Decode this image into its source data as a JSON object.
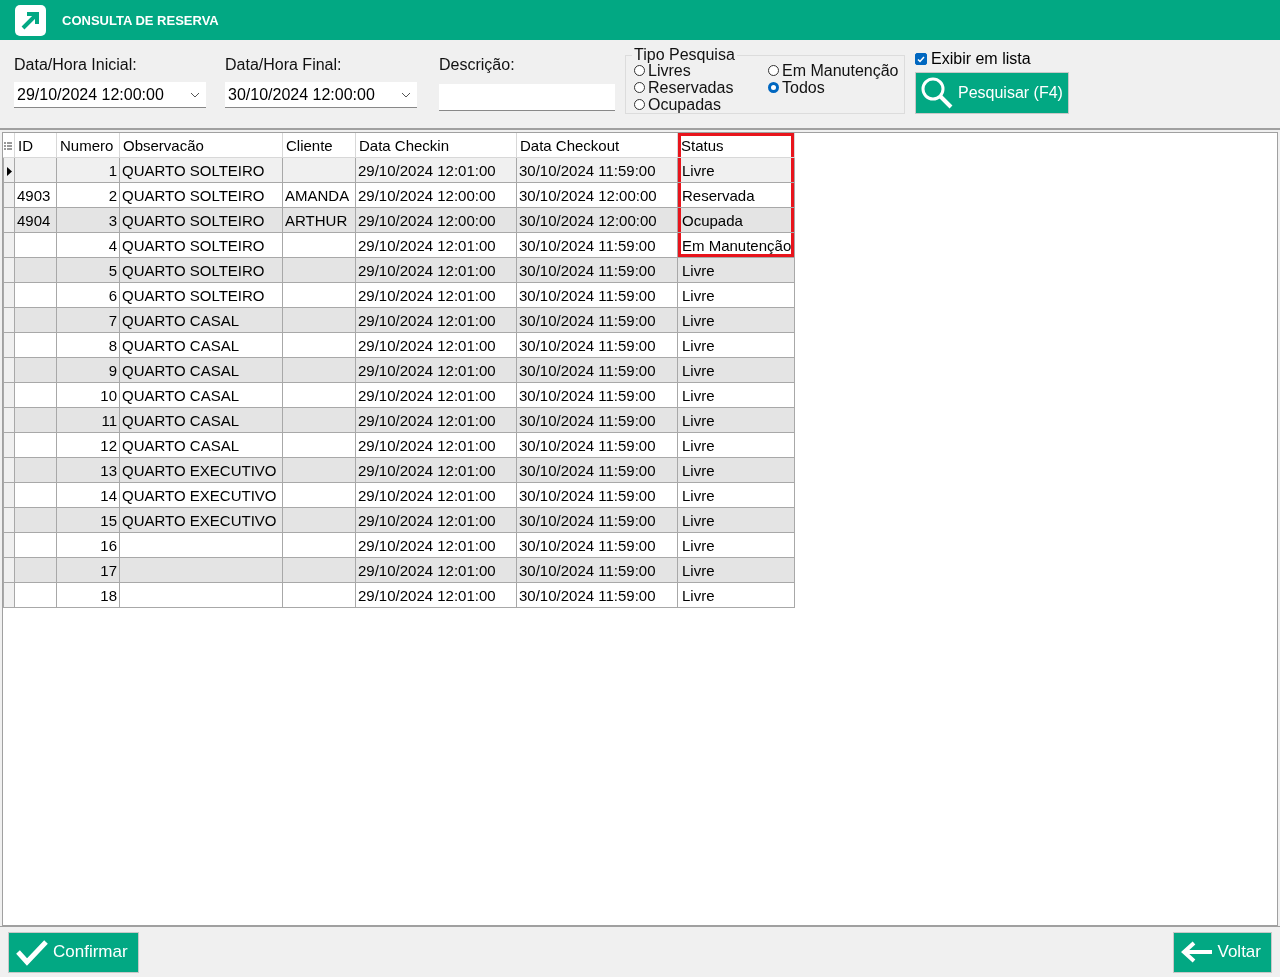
{
  "window": {
    "title": "CONSULTA DE RESERVA"
  },
  "filters": {
    "start": {
      "label": "Data/Hora Inicial:",
      "value": "29/10/2024 12:00:00"
    },
    "end": {
      "label": "Data/Hora Final:",
      "value": "30/10/2024 12:00:00"
    },
    "description": {
      "label": "Descrição:"
    }
  },
  "search_type": {
    "title": "Tipo Pesquisa",
    "options": [
      {
        "label": "Livres",
        "selected": false
      },
      {
        "label": "Reservadas",
        "selected": false
      },
      {
        "label": "Ocupadas",
        "selected": false
      },
      {
        "label": "Em Manutenção",
        "selected": false
      },
      {
        "label": "Todos",
        "selected": true
      }
    ]
  },
  "show_list": {
    "label": "Exibir em lista",
    "checked": true
  },
  "search_button": "Pesquisar (F4)",
  "table": {
    "columns": [
      "ID",
      "Numero",
      "Observacão",
      "Cliente",
      "Data Checkin",
      "Data Checkout",
      "Status"
    ],
    "rows": [
      {
        "selected": true,
        "highlighted": true,
        "cells": [
          "",
          "1",
          "QUARTO SOLTEIRO",
          "",
          "29/10/2024 12:01:00",
          "30/10/2024 11:59:00",
          "Livre"
        ]
      },
      {
        "selected": false,
        "highlighted": true,
        "cells": [
          "4903",
          "2",
          "QUARTO SOLTEIRO",
          "AMANDA",
          "29/10/2024 12:00:00",
          "30/10/2024 12:00:00",
          "Reservada"
        ]
      },
      {
        "selected": false,
        "highlighted": true,
        "cells": [
          "4904",
          "3",
          "QUARTO SOLTEIRO",
          "ARTHUR",
          "29/10/2024 12:00:00",
          "30/10/2024 12:00:00",
          "Ocupada"
        ]
      },
      {
        "selected": false,
        "highlighted": true,
        "cells": [
          "",
          "4",
          "QUARTO SOLTEIRO",
          "",
          "29/10/2024 12:01:00",
          "30/10/2024 11:59:00",
          "Em Manutenção"
        ]
      },
      {
        "selected": false,
        "highlighted": false,
        "cells": [
          "",
          "5",
          "QUARTO SOLTEIRO",
          "",
          "29/10/2024 12:01:00",
          "30/10/2024 11:59:00",
          "Livre"
        ]
      },
      {
        "selected": false,
        "highlighted": false,
        "cells": [
          "",
          "6",
          "QUARTO SOLTEIRO",
          "",
          "29/10/2024 12:01:00",
          "30/10/2024 11:59:00",
          "Livre"
        ]
      },
      {
        "selected": false,
        "highlighted": false,
        "cells": [
          "",
          "7",
          "QUARTO CASAL",
          "",
          "29/10/2024 12:01:00",
          "30/10/2024 11:59:00",
          "Livre"
        ]
      },
      {
        "selected": false,
        "highlighted": false,
        "cells": [
          "",
          "8",
          "QUARTO CASAL",
          "",
          "29/10/2024 12:01:00",
          "30/10/2024 11:59:00",
          "Livre"
        ]
      },
      {
        "selected": false,
        "highlighted": false,
        "cells": [
          "",
          "9",
          "QUARTO CASAL",
          "",
          "29/10/2024 12:01:00",
          "30/10/2024 11:59:00",
          "Livre"
        ]
      },
      {
        "selected": false,
        "highlighted": false,
        "cells": [
          "",
          "10",
          "QUARTO CASAL",
          "",
          "29/10/2024 12:01:00",
          "30/10/2024 11:59:00",
          "Livre"
        ]
      },
      {
        "selected": false,
        "highlighted": false,
        "cells": [
          "",
          "11",
          "QUARTO CASAL",
          "",
          "29/10/2024 12:01:00",
          "30/10/2024 11:59:00",
          "Livre"
        ]
      },
      {
        "selected": false,
        "highlighted": false,
        "cells": [
          "",
          "12",
          "QUARTO CASAL",
          "",
          "29/10/2024 12:01:00",
          "30/10/2024 11:59:00",
          "Livre"
        ]
      },
      {
        "selected": false,
        "highlighted": false,
        "cells": [
          "",
          "13",
          "QUARTO EXECUTIVO",
          "",
          "29/10/2024 12:01:00",
          "30/10/2024 11:59:00",
          "Livre"
        ]
      },
      {
        "selected": false,
        "highlighted": false,
        "cells": [
          "",
          "14",
          "QUARTO EXECUTIVO",
          "",
          "29/10/2024 12:01:00",
          "30/10/2024 11:59:00",
          "Livre"
        ]
      },
      {
        "selected": false,
        "highlighted": false,
        "cells": [
          "",
          "15",
          "QUARTO EXECUTIVO",
          "",
          "29/10/2024 12:01:00",
          "30/10/2024 11:59:00",
          "Livre"
        ]
      },
      {
        "selected": false,
        "highlighted": false,
        "cells": [
          "",
          "16",
          "",
          "",
          "29/10/2024 12:01:00",
          "30/10/2024 11:59:00",
          "Livre"
        ]
      },
      {
        "selected": false,
        "highlighted": false,
        "cells": [
          "",
          "17",
          "",
          "",
          "29/10/2024 12:01:00",
          "30/10/2024 11:59:00",
          "Livre"
        ]
      },
      {
        "selected": false,
        "highlighted": false,
        "cells": [
          "",
          "18",
          "",
          "",
          "29/10/2024 12:01:00",
          "30/10/2024 11:59:00",
          "Livre"
        ]
      }
    ]
  },
  "footer": {
    "confirm": "Confirmar",
    "back": "Voltar"
  }
}
